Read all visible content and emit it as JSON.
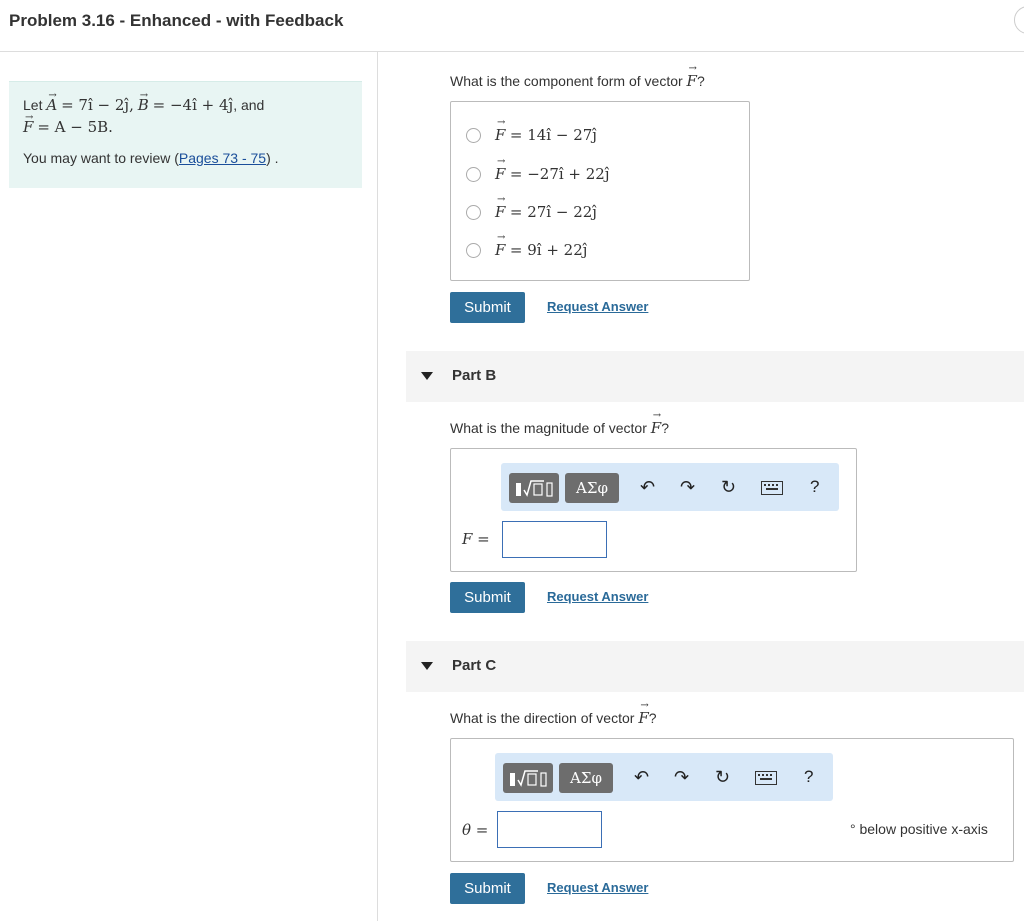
{
  "header": {
    "title": "Problem 3.16 - Enhanced - with Feedback"
  },
  "intro": {
    "let": "Let",
    "and": ", and",
    "a_eq": "= 7î − 2ĵ,",
    "b_eq": "= −4î + 4ĵ",
    "f_eq": "= A − 5B.",
    "review_prefix": "You may want to review (",
    "review_link": "Pages 73 - 75",
    "review_suffix": ") ."
  },
  "partA": {
    "question_prefix": "What is the component form of vector",
    "question_suffix": "?",
    "options": [
      "= 14î − 27ĵ",
      "= −27î + 22ĵ",
      "= 27î − 22ĵ",
      "= 9î + 22ĵ"
    ],
    "submit": "Submit",
    "request": "Request Answer"
  },
  "partB": {
    "label": "Part B",
    "question_prefix": "What is the magnitude of vector",
    "question_suffix": "?",
    "input_label": "F =",
    "input_value": "",
    "submit": "Submit",
    "request": "Request Answer"
  },
  "partC": {
    "label": "Part C",
    "question_prefix": "What is the direction of vector",
    "question_suffix": "?",
    "input_label": "θ =",
    "input_value": "",
    "unit": "° below positive x-axis",
    "submit": "Submit",
    "request": "Request Answer"
  },
  "toolbar": {
    "greek": "ΑΣφ",
    "help": "?"
  },
  "vector_symbol": "F",
  "colors": {
    "submit": "#2f6f9a",
    "link": "#2a6a99",
    "intro_bg": "#e8f5f3",
    "toolbar_bg": "#d8e8f8"
  }
}
